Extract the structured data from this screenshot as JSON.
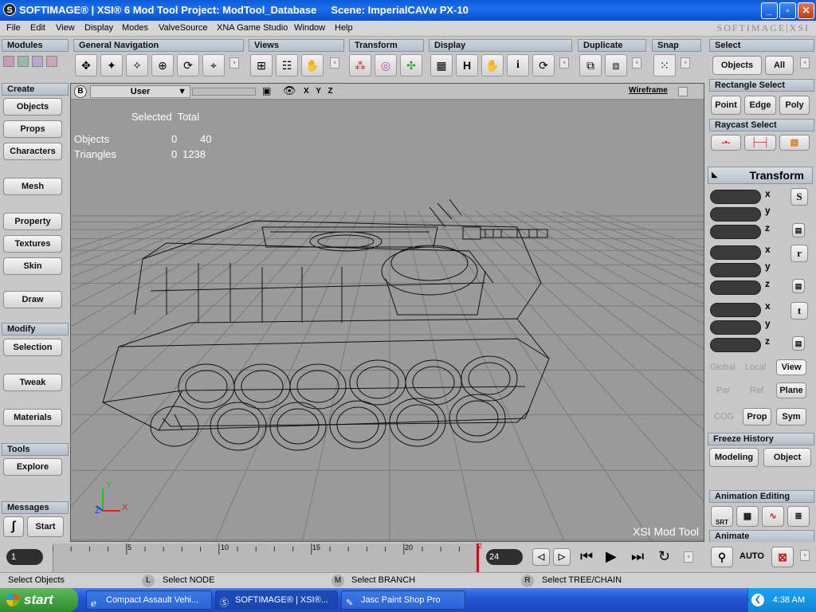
{
  "window": {
    "title": "SOFTIMAGE® | XSI® 6 Mod Tool Project: ModTool_Database     Scene: ImperialCAVw PX-10",
    "brand": "SOFTIMAGE|XSI"
  },
  "menu": [
    "File",
    "Edit",
    "View",
    "Display",
    "Modes",
    "ValveSource",
    "XNA Game Studio",
    "Window",
    "Help"
  ],
  "toolbar": {
    "modules": "Modules",
    "general_navigation": "General Navigation",
    "views": "Views",
    "transform": "Transform",
    "display": "Display",
    "duplicate": "Duplicate",
    "snap": "Snap",
    "display_h": "H",
    "display_i": "i"
  },
  "left_panel": {
    "create_header": "Create",
    "objects": "Objects",
    "props": "Props",
    "characters": "Characters",
    "mesh": "Mesh",
    "property": "Property",
    "textures": "Textures",
    "skin": "Skin",
    "draw": "Draw",
    "modify_header": "Modify",
    "selection": "Selection",
    "tweak": "Tweak",
    "materials": "Materials",
    "tools_header": "Tools",
    "explore": "Explore",
    "messages_header": "Messages",
    "start": "Start"
  },
  "viewport": {
    "camera": "User",
    "axes": "X Y Z",
    "mode": "Wireframe",
    "stats_header": "Selected  Total",
    "objects_label": "Objects",
    "objects_selected": "0",
    "objects_total": "40",
    "triangles_label": "Triangles",
    "triangles_selected": "0",
    "triangles_total": "1238",
    "watermark": "XSI Mod Tool",
    "gizmo_y": "Y",
    "gizmo_z": "Z",
    "gizmo_x": "X"
  },
  "right_panel": {
    "select_header": "Select",
    "objects": "Objects",
    "all": "All",
    "rect_header": "Rectangle Select",
    "point": "Point",
    "edge": "Edge",
    "poly": "Poly",
    "raycast_header": "Raycast Select",
    "transform_header": "Transform",
    "x": "x",
    "y": "y",
    "z": "z",
    "s": "S",
    "r": "r",
    "t": "t",
    "global": "Global",
    "local": "Local",
    "view": "View",
    "par": "Par",
    "ref": "Ref",
    "plane": "Plane",
    "cog": "COG",
    "prop": "Prop",
    "sym": "Sym",
    "freeze_header": "Freeze History",
    "modeling": "Modeling",
    "object": "Object",
    "anim_header": "Animation Editing",
    "srt": "SRT",
    "animate_header": "Animate",
    "auto": "AUTO"
  },
  "timeline": {
    "start_frame": "1",
    "end_frame": "24",
    "ticks": [
      "5",
      "10",
      "15",
      "20"
    ],
    "current_marker": "2"
  },
  "status": {
    "left": "Select Objects",
    "l_key": "L",
    "l_action": "Select NODE",
    "m_key": "M",
    "m_action": "Select BRANCH",
    "r_key": "R",
    "r_action": "Select TREE/CHAIN"
  },
  "taskbar": {
    "start": "start",
    "items": [
      "Compact Assault Vehi...",
      "SOFTIMAGE® | XSI®...",
      "Jasc Paint Shop Pro"
    ],
    "clock": "4:38 AM"
  },
  "colors": {
    "titlebar": "#1c6ef0",
    "viewport_bg": "#9a9a9a",
    "taskbar": "#2456d6",
    "start": "#3a9a3a",
    "timeline_marker": "#d01010"
  }
}
